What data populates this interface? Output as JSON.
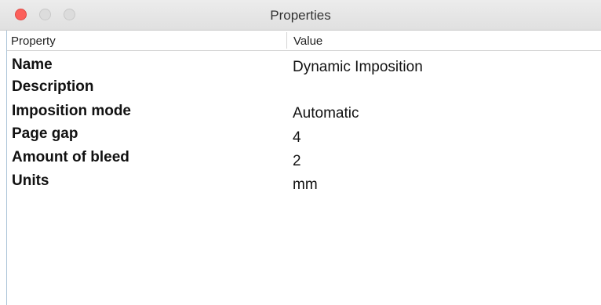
{
  "window": {
    "title": "Properties",
    "controls": {
      "close": "close-button",
      "minimize": "minimize-button",
      "zoom": "zoom-button"
    },
    "colors": {
      "close": "#fc605b",
      "inactive": "#dcdcdc",
      "left_border": "#a9c3d8"
    }
  },
  "table": {
    "columns": {
      "property": "Property",
      "value": "Value"
    },
    "rows": [
      {
        "label": "Name",
        "value": "Dynamic Imposition"
      },
      {
        "label": "Description",
        "value": ""
      },
      {
        "label": "Imposition mode",
        "value": "Automatic"
      },
      {
        "label": "Page gap",
        "value": "4"
      },
      {
        "label": "Amount of bleed",
        "value": "2"
      },
      {
        "label": "Units",
        "value": "mm"
      }
    ]
  }
}
